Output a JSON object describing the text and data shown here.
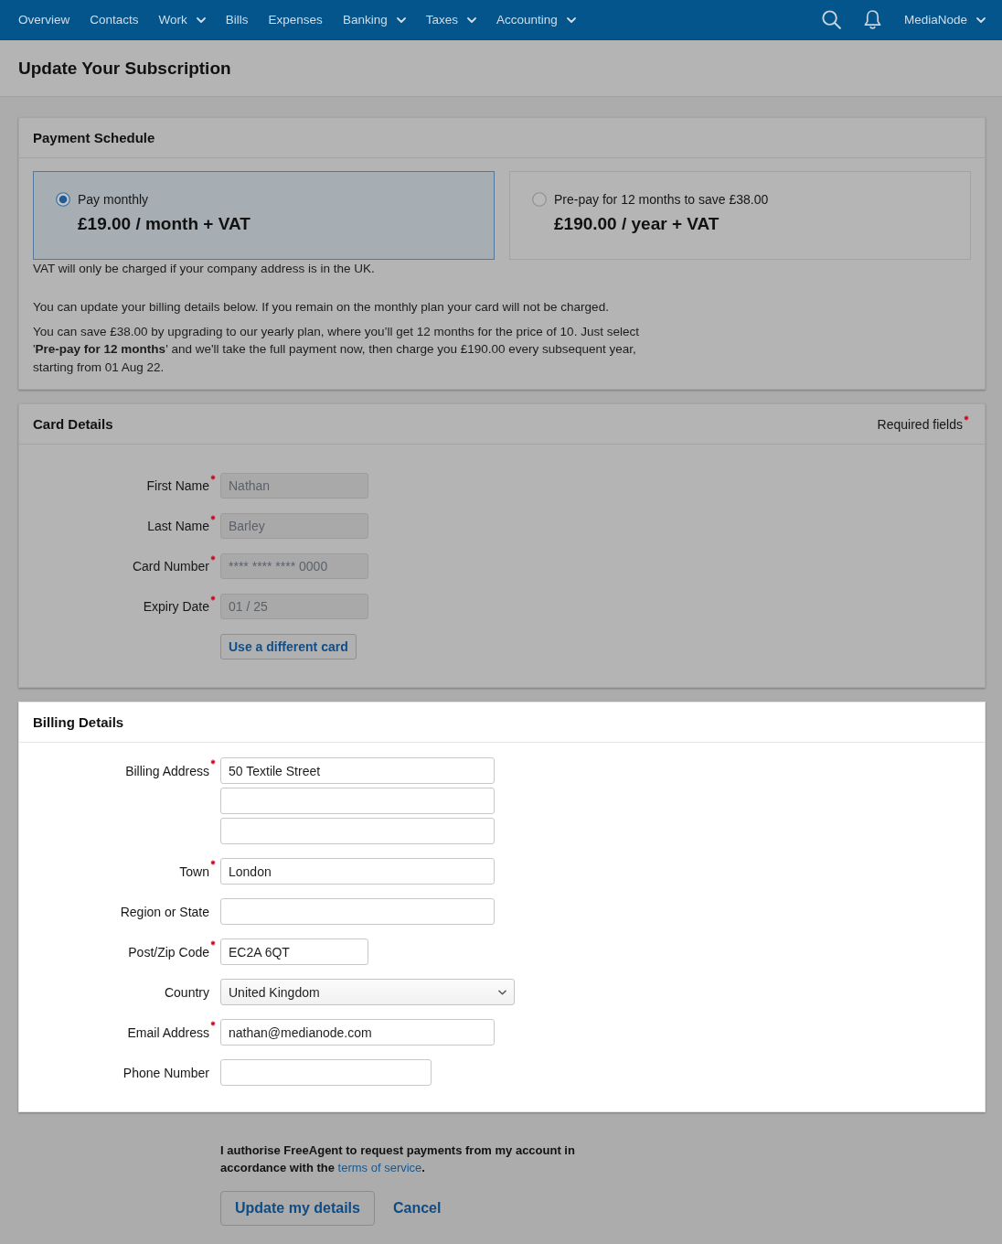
{
  "nav": {
    "items": [
      {
        "label": "Overview",
        "dropdown": false
      },
      {
        "label": "Contacts",
        "dropdown": false
      },
      {
        "label": "Work",
        "dropdown": true
      },
      {
        "label": "Bills",
        "dropdown": false
      },
      {
        "label": "Expenses",
        "dropdown": false
      },
      {
        "label": "Banking",
        "dropdown": true
      },
      {
        "label": "Taxes",
        "dropdown": true
      },
      {
        "label": "Accounting",
        "dropdown": true
      }
    ],
    "account": {
      "label": "MediaNode",
      "dropdown": true
    }
  },
  "page": {
    "title": "Update Your Subscription"
  },
  "payment_schedule": {
    "title": "Payment Schedule",
    "focused": false,
    "options": [
      {
        "label": "Pay monthly",
        "price": "£19.00 / month + VAT",
        "selected": true
      },
      {
        "label": "Pre-pay for 12 months to save £38.00",
        "price": "£190.00 / year + VAT",
        "selected": false
      }
    ],
    "vat_note": "VAT will only be charged if your company address is in the UK.",
    "paragraphs": [
      "You can update your billing details below. If you remain on the monthly plan your card will not be charged.",
      "You can save £38.00 by upgrading to our yearly plan, where you’ll get 12 months for the price of 10. Just select '**Pre-pay for 12 months**' and we'll take the full payment now, then charge you £190.00 every subsequent year, starting from 01 Aug 22."
    ]
  },
  "card_details": {
    "title": "Card Details",
    "focused": false,
    "required_note": "Required fields",
    "fields": [
      {
        "label": "First Name",
        "required": true,
        "disabled": true,
        "value": "Nathan"
      },
      {
        "label": "Last Name",
        "required": true,
        "disabled": true,
        "value": "Barley"
      },
      {
        "label": "Card Number",
        "required": true,
        "disabled": true,
        "value": "**** **** **** 0000"
      },
      {
        "label": "Expiry Date",
        "required": true,
        "disabled": true,
        "value": "01 / 25"
      }
    ],
    "button": "Use a different card"
  },
  "billing_details": {
    "title": "Billing Details",
    "focused": true,
    "fields": [
      {
        "label": "Billing Address",
        "required": true,
        "kind": "text",
        "value": "50 Textile Street"
      },
      {
        "kind": "text"
      },
      {
        "kind": "text"
      },
      {
        "label": "Town",
        "required": true,
        "kind": "text",
        "value": "London"
      },
      {
        "label": "Region or State",
        "required": false,
        "kind": "text"
      },
      {
        "label": "Post/Zip Code",
        "required": true,
        "kind": "postcode",
        "value": "EC2A 6QT"
      },
      {
        "label": "Country",
        "required": false,
        "kind": "select",
        "value": "United Kingdom"
      },
      {
        "label": "Email Address",
        "required": true,
        "kind": "email",
        "value": "nathan@medianode.com"
      },
      {
        "label": "Phone Number",
        "required": false,
        "kind": "phone"
      }
    ]
  },
  "authorisation": {
    "text": "I authorise FreeAgent to request payments from my account in accordance with the",
    "link": "terms of service",
    "after": "."
  },
  "actions": {
    "submit": "Update my details",
    "cancel": "Cancel"
  }
}
